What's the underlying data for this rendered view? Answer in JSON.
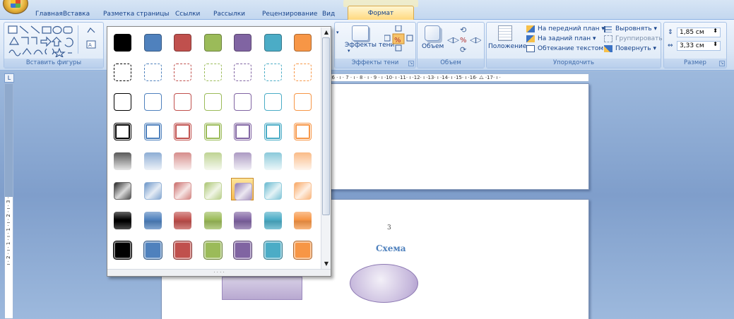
{
  "tabs": [
    "Главная",
    "Вставка",
    "Разметка страницы",
    "Ссылки",
    "Рассылки",
    "Рецензирование",
    "Вид",
    "Формат"
  ],
  "ribbon": {
    "groups": {
      "insert_shapes": "Вставить фигуры",
      "shadow_effects": "Эффекты тени",
      "volume": "Объем",
      "arrange": "Упорядочить",
      "size": "Размер"
    },
    "shadow_button": "Эффекты тени",
    "volume_button": "Объем",
    "position_button": "Положение",
    "bring_front": "На передний план",
    "send_back": "На задний план",
    "text_wrap": "Обтекание текстом",
    "align": "Выровнять",
    "group": "Группировать",
    "rotate": "Повернуть",
    "height": "1,85 см",
    "width": "3,33 см"
  },
  "ruler": {
    "horizontal": "· 6 · ı · 7 · ı · 8 · ı · 9 · ı ·10· ı ·11· ı ·12· ı ·13· ı ·14· ı ·15· ı ·16· ⧍ ·17· ı ·",
    "vertical": "ı · 2 · ı · 1 · ı · 1 · ı · 2 · ı · 3 ·"
  },
  "document": {
    "page_number": "3",
    "heading": "Схема"
  },
  "gallery": {
    "colors": [
      "#000000",
      "#4f81bd",
      "#c0504d",
      "#9bbb59",
      "#8064a2",
      "#4bacc6",
      "#f79646"
    ],
    "rows": [
      "solid",
      "dashed",
      "outline",
      "thick-outline",
      "light-gradient",
      "diagonal-gradient",
      "moderate-gradient",
      "intense"
    ],
    "selected": {
      "row": 5,
      "col": 4
    }
  }
}
